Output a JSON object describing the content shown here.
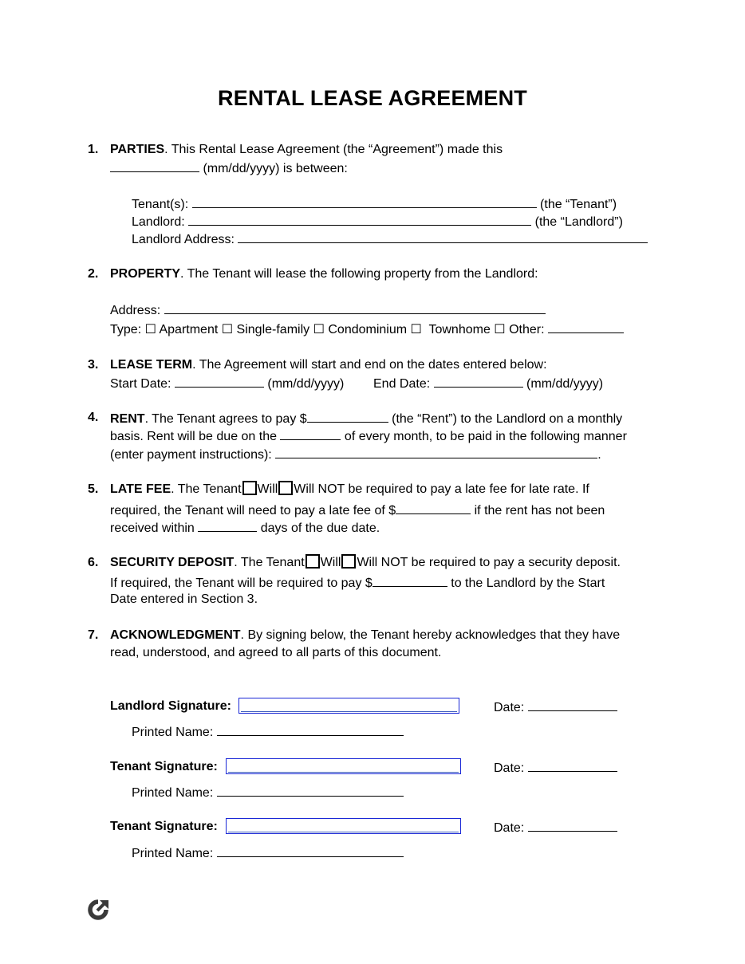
{
  "document": {
    "title": "RENTAL LEASE AGREEMENT",
    "logo_icon": "refresh-arrow-logo-icon"
  },
  "sections": {
    "parties": {
      "number": "1.",
      "heading": "PARTIES",
      "text_1": ". This Rental Lease Agreement (the “Agreement”) made this",
      "text_2": " (mm/dd/yyyy) is between:",
      "tenant_label": "Tenant(s): ",
      "tenant_suffix": " (the “Tenant”)",
      "landlord_label": "Landlord: ",
      "landlord_suffix": " (the “Landlord”)",
      "landlord_address_label": "Landlord Address: ",
      "date_value": "",
      "tenant_value": "",
      "landlord_value": "",
      "landlord_address_value": ""
    },
    "property": {
      "number": "2.",
      "heading": "PROPERTY",
      "text": ". The Tenant will lease the following property from the Landlord:",
      "address_label": "Address: ",
      "address_value": "",
      "type_label": "Type: ",
      "checkbox_glyph": "☐",
      "types": [
        {
          "label": " Apartment ",
          "checked": false
        },
        {
          "label": " Single-family ",
          "checked": false
        },
        {
          "label": " Condominium ",
          "checked": false
        },
        {
          "label": "  Townhome ",
          "checked": false
        },
        {
          "label": " Other: ",
          "checked": false
        }
      ],
      "other_value": ""
    },
    "lease_term": {
      "number": "3.",
      "heading": "LEASE TERM",
      "text": ". The Agreement will start and end on the dates entered below:",
      "start_label": "Start Date: ",
      "start_format": " (mm/dd/yyyy)",
      "end_label": "End Date: ",
      "end_format": " (mm/dd/yyyy)",
      "start_value": "",
      "end_value": ""
    },
    "rent": {
      "number": "4.",
      "heading": "RENT",
      "text_1a": ". The Tenant agrees to pay $",
      "text_1b": " (the “Rent”) to the Landlord on a monthly",
      "text_2a": "basis. Rent will be due on the ",
      "text_2b": " of every month, to be paid in the following manner",
      "text_3a": "(enter payment instructions): ",
      "text_3b": ".",
      "amount_value": "",
      "due_day_value": "",
      "instructions_value": ""
    },
    "late_fee": {
      "number": "5.",
      "heading": "LATE FEE",
      "text_1a": ". The Tenant",
      "will_label": "Will",
      "will_not_label": "Will NOT be required to pay a late fee for late rate. If",
      "text_2a": "required, the Tenant will need to pay a late fee of $",
      "text_2b": " if the rent has not been",
      "text_3a": "received within ",
      "text_3b": " days of the due date.",
      "will_checked": false,
      "will_not_checked": false,
      "fee_value": "",
      "days_value": ""
    },
    "security_deposit": {
      "number": "6.",
      "heading": "SECURITY DEPOSIT",
      "text_1a": ". The Tenant",
      "will_label": "Will",
      "will_not_label": "Will NOT be required to pay a security deposit.",
      "text_2a": "If required, the Tenant will be required to pay $",
      "text_2b": " to the Landlord by the Start",
      "text_3": "Date entered in Section 3.",
      "will_checked": false,
      "will_not_checked": false,
      "deposit_value": ""
    },
    "acknowledgment": {
      "number": "7.",
      "heading": "ACKNOWLEDGMENT",
      "text_1": ". By signing below, the Tenant hereby acknowledges that they have",
      "text_2": "read, understood, and agreed to all parts of this document."
    }
  },
  "signatures": [
    {
      "label": "Landlord Signature:",
      "date_label": "Date: ",
      "printed_name_label": "Printed Name: ",
      "signature_value": "",
      "date_value": "",
      "printed_name_value": ""
    },
    {
      "label": "Tenant Signature:",
      "date_label": "Date: ",
      "printed_name_label": "Printed Name: ",
      "signature_value": "",
      "date_value": "",
      "printed_name_value": ""
    },
    {
      "label": "Tenant Signature:",
      "date_label": "Date: ",
      "printed_name_label": "Printed Name: ",
      "signature_value": "",
      "date_value": "",
      "printed_name_value": ""
    }
  ],
  "colors": {
    "signature_field_border": "#1a28d6",
    "logo": "#3a3a3a"
  }
}
